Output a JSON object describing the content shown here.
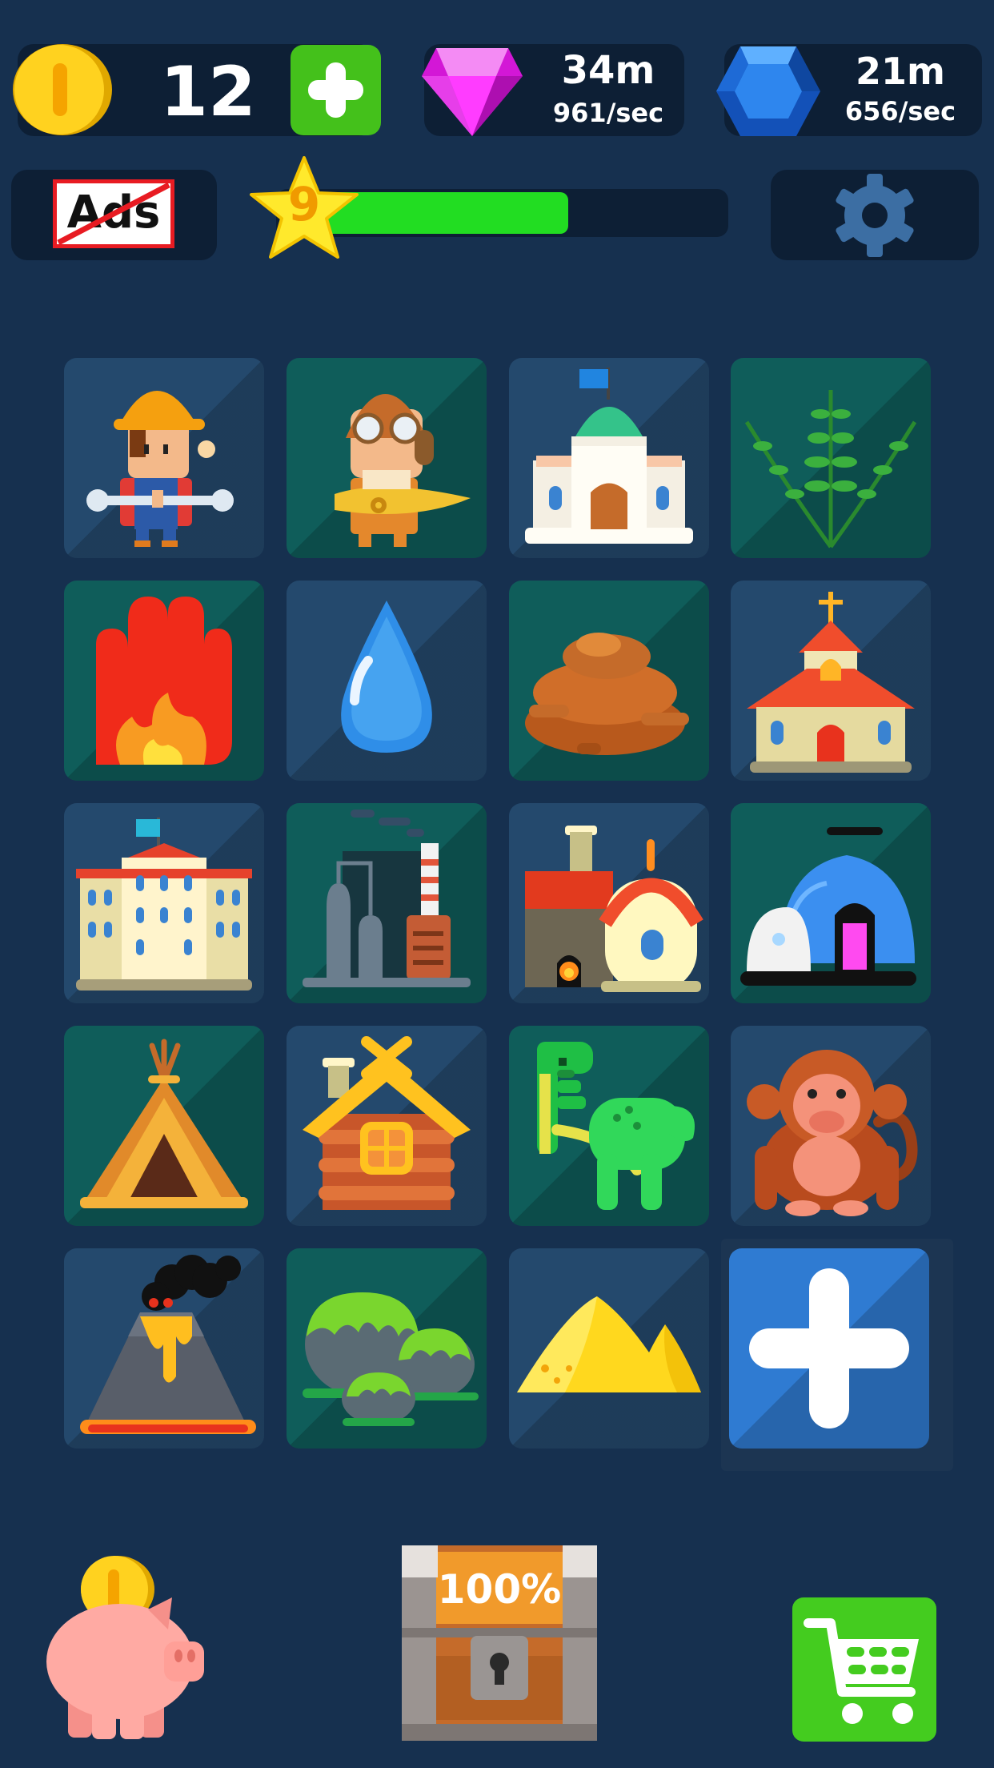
{
  "hud": {
    "coins": "12",
    "pink_gem_total": "34m",
    "pink_gem_rate": "961/sec",
    "blue_gem_total": "21m",
    "blue_gem_rate": "656/sec"
  },
  "ads_button_label": "Ads",
  "level": {
    "number": "9",
    "progress": 0.5
  },
  "chest_label": "100%",
  "grid": [
    {
      "name": "engineer",
      "icon": "engineer-icon",
      "bg": "b"
    },
    {
      "name": "pilot",
      "icon": "pilot-icon",
      "bg": "g"
    },
    {
      "name": "observatory",
      "icon": "observatory-icon",
      "bg": "b"
    },
    {
      "name": "fern",
      "icon": "fern-icon",
      "bg": "g"
    },
    {
      "name": "fire",
      "icon": "fire-icon",
      "bg": "g"
    },
    {
      "name": "water",
      "icon": "water-drop-icon",
      "bg": "b"
    },
    {
      "name": "mud",
      "icon": "mud-icon",
      "bg": "g"
    },
    {
      "name": "church",
      "icon": "church-icon",
      "bg": "b"
    },
    {
      "name": "school",
      "icon": "school-building-icon",
      "bg": "b"
    },
    {
      "name": "factory",
      "icon": "factory-icon",
      "bg": "g"
    },
    {
      "name": "bakery",
      "icon": "bakery-icon",
      "bg": "b"
    },
    {
      "name": "lab",
      "icon": "laboratory-icon",
      "bg": "g"
    },
    {
      "name": "tent",
      "icon": "tent-icon",
      "bg": "g"
    },
    {
      "name": "cabin",
      "icon": "log-cabin-icon",
      "bg": "b"
    },
    {
      "name": "dinosaur",
      "icon": "dinosaur-icon",
      "bg": "g"
    },
    {
      "name": "monkey",
      "icon": "monkey-icon",
      "bg": "b"
    },
    {
      "name": "volcano",
      "icon": "volcano-icon",
      "bg": "b"
    },
    {
      "name": "moss-rocks",
      "icon": "moss-rocks-icon",
      "bg": "g"
    },
    {
      "name": "sand",
      "icon": "sand-dunes-icon",
      "bg": "b"
    },
    {
      "name": "add",
      "icon": "plus-icon",
      "bg": "add"
    }
  ],
  "colors": {
    "background": "#16304f",
    "panel": "#0d1f35",
    "progress": "#22dd22",
    "add_tile": "#2f7bd2",
    "shop": "#44cc1f"
  }
}
